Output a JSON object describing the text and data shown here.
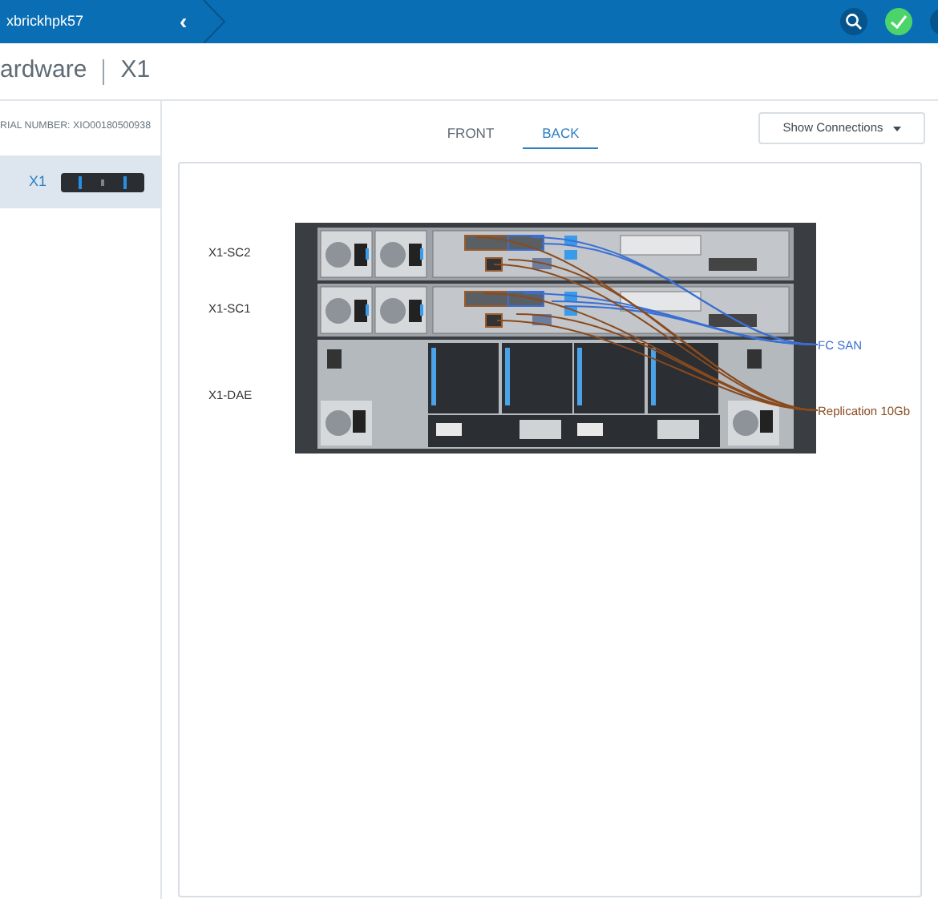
{
  "header": {
    "system_name": "xbrickhpk57",
    "collapse_icon": "‹",
    "healthy": true
  },
  "page_title": {
    "section": "ardware",
    "item": "X1"
  },
  "sidebar": {
    "serial": "RIAL NUMBER: XIO00180500938",
    "items": [
      {
        "label": "X1",
        "selected": true
      }
    ]
  },
  "tabs": [
    {
      "label": "FRONT",
      "selected": false
    },
    {
      "label": "BACK",
      "selected": true
    }
  ],
  "connections_button": {
    "label": "Show Connections"
  },
  "diagram": {
    "components": [
      {
        "label": "X1-SC2",
        "kind": "controller"
      },
      {
        "label": "X1-SC1",
        "kind": "controller"
      },
      {
        "label": "X1-DAE",
        "kind": "enclosure"
      }
    ],
    "connections": [
      {
        "label": "FC SAN",
        "color": "#3b6fd4"
      },
      {
        "label": "Replication 10Gb",
        "color": "#8a4a1e"
      }
    ]
  }
}
